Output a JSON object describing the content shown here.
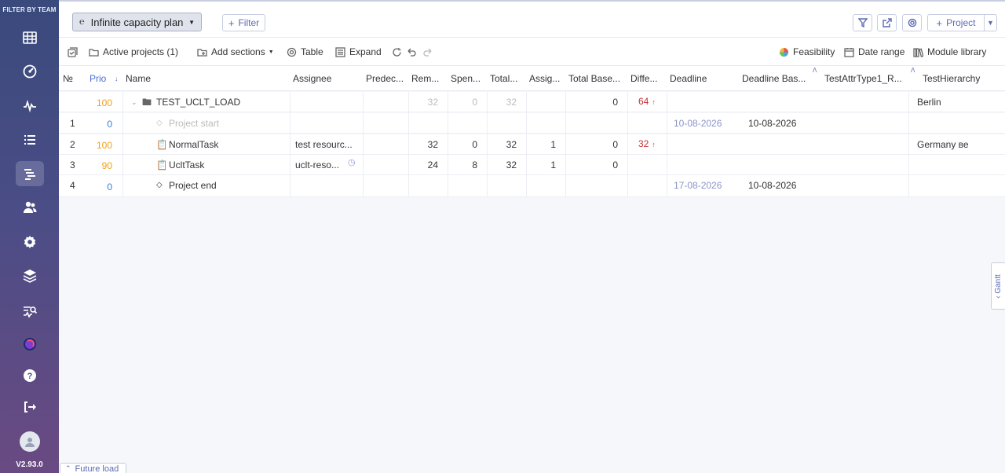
{
  "sidebar": {
    "team_label": "FILTER BY TEAM",
    "version": "V2.93.0",
    "icons": [
      "grid-icon",
      "dashboard-icon",
      "activity-icon",
      "list-icon",
      "gantt-icon",
      "users-icon",
      "settings-icon",
      "layers-icon",
      "search-analytics-icon",
      "brand-logo-icon",
      "help-icon",
      "logout-icon"
    ]
  },
  "topbar": {
    "plan_label": "Infinite capacity plan",
    "filter_label": "Filter",
    "project_label": "Project"
  },
  "toolbar": {
    "active_projects": "Active projects (1)",
    "add_sections": "Add sections",
    "table": "Table",
    "expand": "Expand",
    "feasibility": "Feasibility",
    "date_range": "Date range",
    "module_library": "Module library"
  },
  "columns": {
    "no": "№",
    "prio": "Prio",
    "name": "Name",
    "assignee": "Assignee",
    "predecessors": "Predec...",
    "remaining": "Rem...",
    "spent": "Spen...",
    "total": "Total...",
    "assigned": "Assig...",
    "total_baseline": "Total Base...",
    "difference": "Diffe...",
    "deadline": "Deadline",
    "deadline_baseline": "Deadline Bas...",
    "attr": "TestAttrType1_R...",
    "hierarchy": "TestHierarchy"
  },
  "rows": [
    {
      "no": "",
      "prio": "100",
      "name": "TEST_UCLT_LOAD",
      "assignee": "",
      "rem": "32",
      "spent": "0",
      "total": "32",
      "assig": "",
      "tbase": "0",
      "diff": "64",
      "deadline": "",
      "dbase": "",
      "hier": "Berlin"
    },
    {
      "no": "1",
      "prio": "0",
      "name": "Project start",
      "assignee": "",
      "rem": "",
      "spent": "",
      "total": "",
      "assig": "",
      "tbase": "",
      "diff": "",
      "deadline": "10-08-2026",
      "dbase": "10-08-2026",
      "hier": ""
    },
    {
      "no": "2",
      "prio": "100",
      "name": "NormalTask",
      "assignee": "test resourc...",
      "rem": "32",
      "spent": "0",
      "total": "32",
      "assig": "1",
      "tbase": "0",
      "diff": "32",
      "deadline": "",
      "dbase": "",
      "hier": "Germany ве"
    },
    {
      "no": "3",
      "prio": "90",
      "name": "UcltTask",
      "assignee": "uclt-reso...",
      "rem": "24",
      "spent": "8",
      "total": "32",
      "assig": "1",
      "tbase": "0",
      "diff": "",
      "deadline": "",
      "dbase": "",
      "hier": ""
    },
    {
      "no": "4",
      "prio": "0",
      "name": "Project end",
      "assignee": "",
      "rem": "",
      "spent": "",
      "total": "",
      "assig": "",
      "tbase": "",
      "diff": "",
      "deadline": "17-08-2026",
      "dbase": "10-08-2026",
      "hier": ""
    }
  ],
  "gantt_tab": "Gantt",
  "future_load": "Future load"
}
